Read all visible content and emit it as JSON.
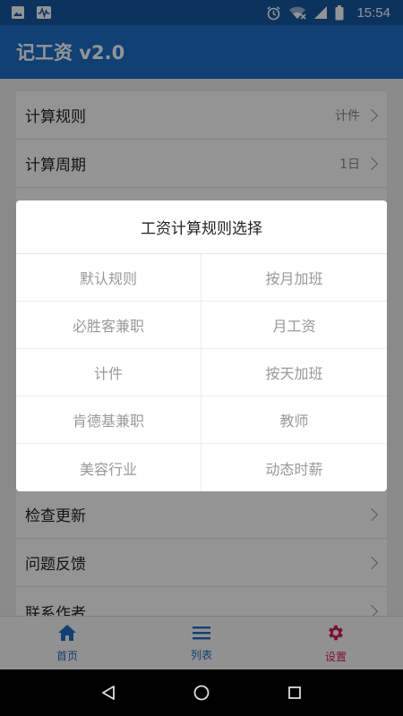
{
  "status_bar": {
    "time": "15:54",
    "icons": [
      "image-icon",
      "activity-icon",
      "alarm-icon",
      "wifi-icon",
      "signal-icon",
      "battery-icon"
    ]
  },
  "app_bar": {
    "title": "记工资 v2.0"
  },
  "settings": {
    "rows": [
      {
        "label": "计算规则",
        "value": "计件"
      },
      {
        "label": "计算周期",
        "value": "1日"
      }
    ],
    "lower_rows": [
      {
        "label": "检查更新"
      },
      {
        "label": "问题反馈"
      },
      {
        "label": "联系作者"
      }
    ]
  },
  "dialog": {
    "title": "工资计算规则选择",
    "options": [
      "默认规则",
      "按月加班",
      "必胜客兼职",
      "月工资",
      "计件",
      "按天加班",
      "肯德基兼职",
      "教师",
      "美容行业",
      "动态时薪"
    ]
  },
  "bottom_nav": {
    "home": "首页",
    "list": "列表",
    "settings": "设置"
  },
  "colors": {
    "primary": "#1d6fc8",
    "status_bar": "#1558a0",
    "accent": "#d81b60"
  }
}
